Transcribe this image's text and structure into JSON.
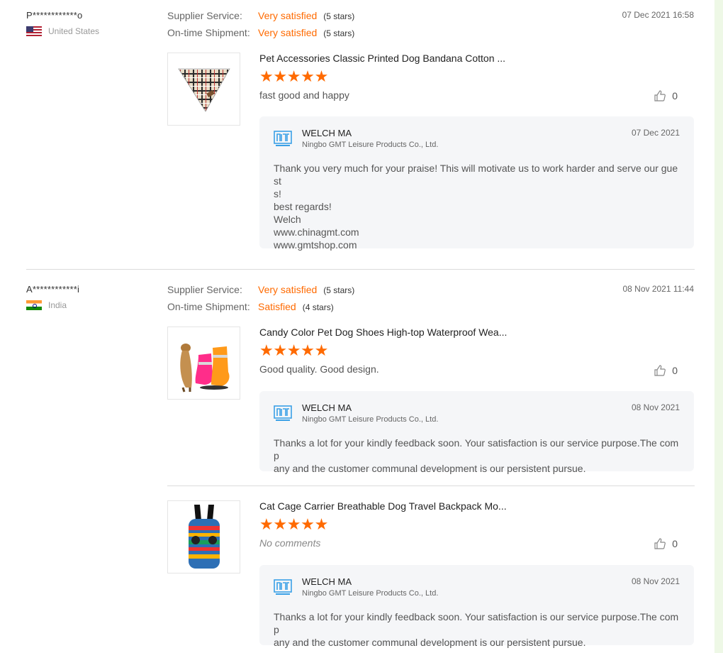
{
  "reviews": [
    {
      "buyer": "P************o",
      "country": "United States",
      "date": "07 Dec 2021 16:58",
      "supplier_service": {
        "label": "Supplier Service:",
        "value": "Very satisfied",
        "stars": "(5 stars)"
      },
      "shipment": {
        "label": "On-time Shipment:",
        "value": "Very satisfied",
        "stars": "(5 stars)"
      },
      "products": [
        {
          "title": "Pet Accessories Classic Printed Dog Bandana Cotton ...",
          "rating": 5,
          "comment": "fast good and happy",
          "likes": "0",
          "reply": {
            "name": "WELCH MA",
            "company": "Ningbo GMT Leisure Products Co., Ltd.",
            "date": "07 Dec 2021",
            "text": "Thank you very much for your praise! This will motivate us to work harder and serve our guest\ns!\nbest regards!\nWelch\nwww.chinagmt.com\nwww.gmtshop.com"
          }
        }
      ]
    },
    {
      "buyer": "A************i",
      "country": "India",
      "date": "08 Nov 2021 11:44",
      "supplier_service": {
        "label": "Supplier Service:",
        "value": "Very satisfied",
        "stars": "(5 stars)"
      },
      "shipment": {
        "label": "On-time Shipment:",
        "value": "Satisfied",
        "stars": "(4 stars)"
      },
      "products": [
        {
          "title": "Candy Color Pet Dog Shoes High-top Waterproof Wea...",
          "rating": 5,
          "comment": "Good quality. Good design.",
          "likes": "0",
          "reply": {
            "name": "WELCH MA",
            "company": "Ningbo GMT Leisure Products Co., Ltd.",
            "date": "08 Nov 2021",
            "text": "Thanks a lot for your kindly feedback soon. Your satisfaction is our service purpose.The comp\nany and the customer communal development is our persistent pursue."
          }
        },
        {
          "title": "Cat Cage Carrier Breathable Dog Travel Backpack Mo...",
          "rating": 5,
          "comment": "No comments",
          "likes": "0",
          "reply": {
            "name": "WELCH MA",
            "company": "Ningbo GMT Leisure Products Co., Ltd.",
            "date": "08 Nov 2021",
            "text": "Thanks a lot for your kindly feedback soon. Your satisfaction is our service purpose.The comp\nany and the customer communal development is our persistent pursue."
          }
        }
      ]
    }
  ],
  "colors": {
    "accent": "#ff6a00",
    "reply_bg": "#f5f6f8",
    "logo": "#3aa0e6"
  },
  "icons": {
    "like": "thumbs-up-icon",
    "star": "star-icon",
    "supplier_logo": "gmt-logo-icon"
  }
}
